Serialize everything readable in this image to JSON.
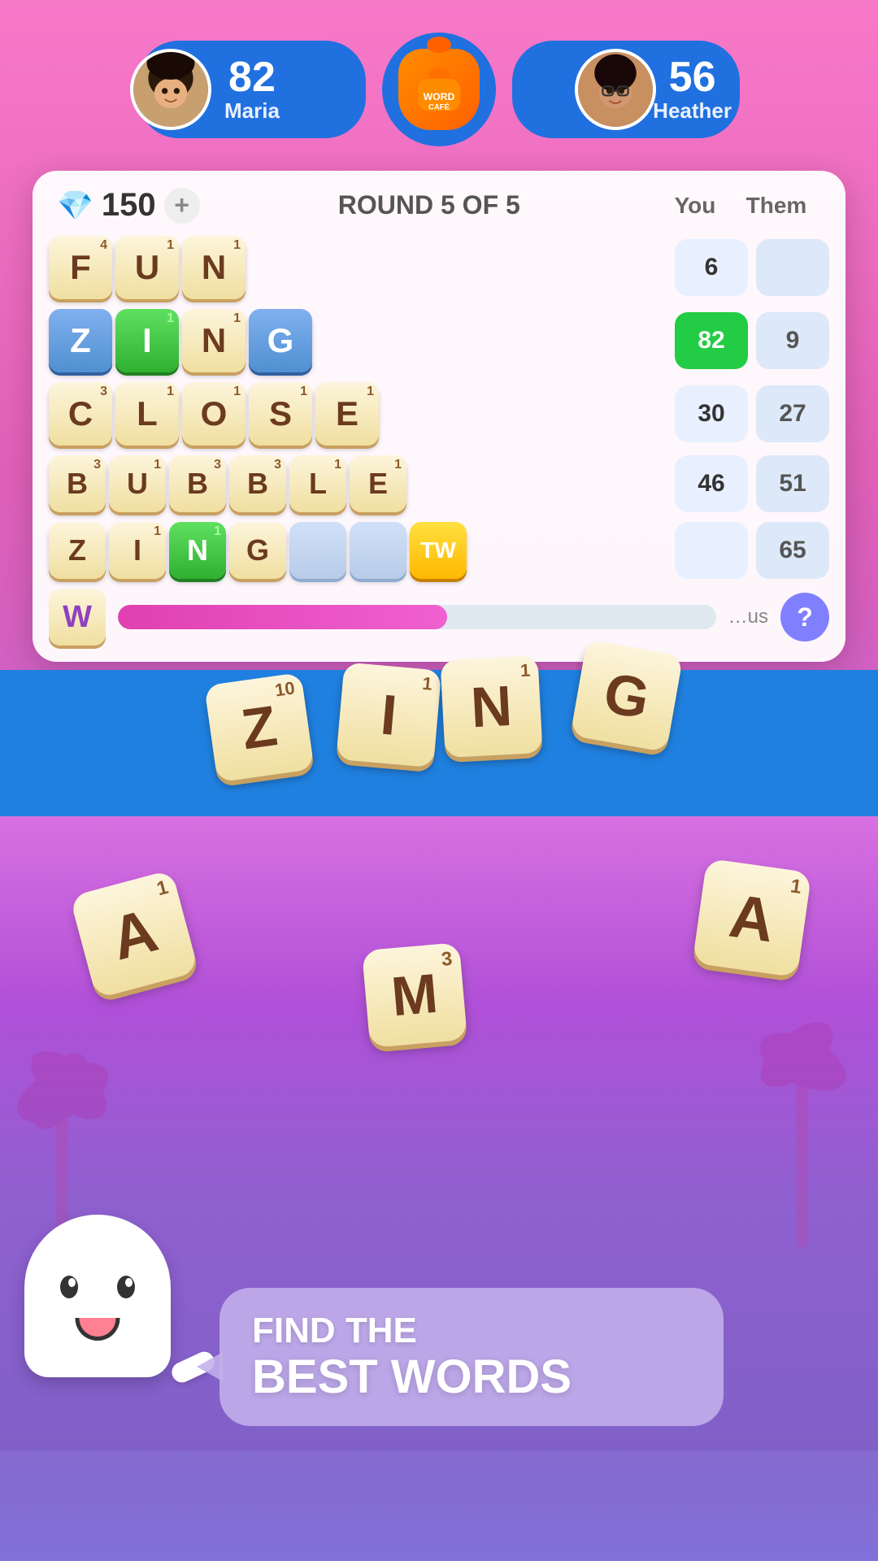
{
  "header": {
    "player_left": {
      "name": "Maria",
      "score": "82"
    },
    "player_right": {
      "name": "Heather",
      "score": "56"
    }
  },
  "panel": {
    "gems": "150",
    "round_text": "ROUND 5 OF 5",
    "col_you": "You",
    "col_them": "Them",
    "plus_label": "+",
    "words": [
      {
        "letters": [
          "F",
          "U",
          "N"
        ],
        "scores": [
          {
            "value": "6",
            "type": "you"
          },
          {
            "value": "",
            "type": "them"
          }
        ],
        "letter_styles": [
          "normal",
          "normal",
          "normal"
        ]
      },
      {
        "letters": [
          "Z",
          "I",
          "N",
          "G"
        ],
        "scores": [
          {
            "value": "82",
            "type": "you-highlight"
          },
          {
            "value": "9",
            "type": "them"
          }
        ],
        "letter_styles": [
          "blue",
          "green",
          "normal",
          "blue"
        ]
      },
      {
        "letters": [
          "C",
          "L",
          "O",
          "S",
          "E"
        ],
        "scores": [
          {
            "value": "30",
            "type": "you"
          },
          {
            "value": "27",
            "type": "them"
          }
        ],
        "letter_styles": [
          "normal",
          "normal",
          "normal",
          "normal",
          "normal"
        ]
      },
      {
        "letters": [
          "B",
          "U",
          "B",
          "B",
          "L",
          "E"
        ],
        "scores": [
          {
            "value": "46",
            "type": "you"
          },
          {
            "value": "51",
            "type": "them"
          }
        ],
        "letter_styles": [
          "normal",
          "normal",
          "normal",
          "normal",
          "normal",
          "normal"
        ],
        "letter_scores": [
          "3",
          "1",
          "3",
          "3",
          "1",
          "1"
        ]
      },
      {
        "letters": [
          "Z",
          "I",
          "N",
          "G",
          "",
          "",
          "TW"
        ],
        "scores": [
          {
            "value": "",
            "type": "you"
          },
          {
            "value": "65",
            "type": "them"
          }
        ],
        "letter_styles": [
          "normal",
          "normal",
          "green",
          "normal",
          "empty",
          "empty",
          "yellow"
        ]
      }
    ],
    "progress": {
      "w_letter": "W",
      "bonus_label": "us",
      "fill_pct": 55
    }
  },
  "tray": {
    "tiles": [
      {
        "letter": "Z",
        "score": "10"
      },
      {
        "letter": "I",
        "score": "1"
      },
      {
        "letter": "N",
        "score": "1"
      },
      {
        "letter": "G",
        "score": ""
      }
    ]
  },
  "floating_tiles": [
    {
      "letter": "A",
      "score": "1"
    },
    {
      "letter": "M",
      "score": "3"
    },
    {
      "letter": "A",
      "score": "1"
    }
  ],
  "mascot": {
    "speech_line1": "FIND THE",
    "speech_line2": "BEST WORDS"
  },
  "letter_score_map": {
    "F": "4",
    "U": "1",
    "N": "1",
    "Z": "10",
    "I": "1",
    "G": "",
    "C": "3",
    "L": "1",
    "O": "1",
    "S": "1",
    "E": "1"
  }
}
